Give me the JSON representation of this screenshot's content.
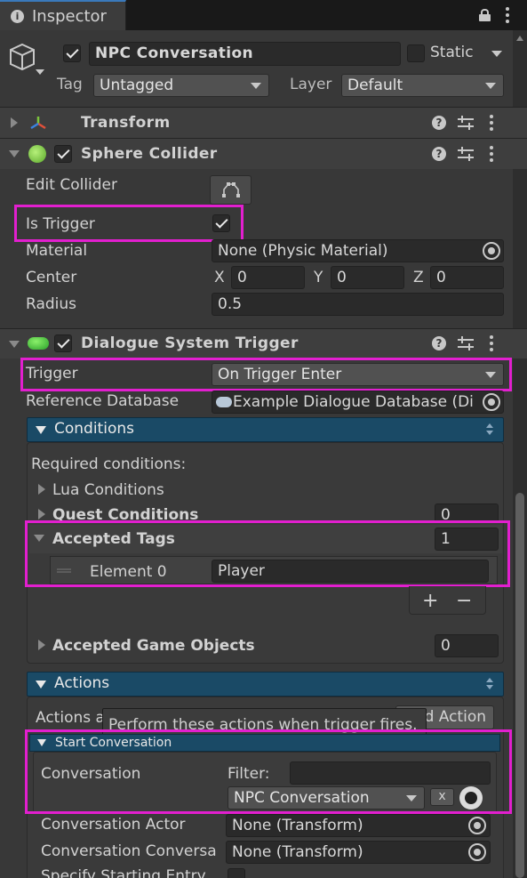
{
  "window": {
    "tab_title": "Inspector"
  },
  "go": {
    "name": "NPC Conversation",
    "static_label": "Static",
    "tag_label": "Tag",
    "tag_value": "Untagged",
    "layer_label": "Layer",
    "layer_value": "Default"
  },
  "transform": {
    "title": "Transform"
  },
  "sphere": {
    "title": "Sphere Collider",
    "edit_collider": "Edit Collider",
    "is_trigger": "Is Trigger",
    "material_label": "Material",
    "material_value": "None (Physic Material)",
    "center_label": "Center",
    "x_label": "X",
    "x": "0",
    "y_label": "Y",
    "y": "0",
    "z_label": "Z",
    "z": "0",
    "radius_label": "Radius",
    "radius": "0.5"
  },
  "dst": {
    "title": "Dialogue System Trigger",
    "trigger_label": "Trigger",
    "trigger_value": "On Trigger Enter",
    "refdb_label": "Reference Database",
    "refdb_value": "Example Dialogue Database (Di"
  },
  "conditions": {
    "header": "Conditions",
    "required": "Required conditions:",
    "lua": "Lua Conditions",
    "quest": "Quest Conditions",
    "quest_count": "0",
    "tags": "Accepted Tags",
    "tags_count": "1",
    "element0_label": "Element 0",
    "element0_value": "Player",
    "plus": "+",
    "minus": "−",
    "gameobjects": "Accepted Game Objects",
    "gameobjects_count": "0"
  },
  "actions": {
    "header": "Actions",
    "actions_label": "Actions a",
    "add_action": "d Action",
    "tooltip": "Perform these actions when trigger fires.",
    "start_conv": "Start Conversation",
    "conversation_label": "Conversation",
    "filter_label": "Filter:",
    "filter_value": "",
    "conv_value": "NPC Conversation",
    "x_btn": "x",
    "actor_label": "Conversation Actor",
    "actor_value": "None (Transform)",
    "conversant_label": "Conversation Conversa",
    "conversant_value": "None (Transform)",
    "specify_label": "Specify Starting Entry"
  }
}
